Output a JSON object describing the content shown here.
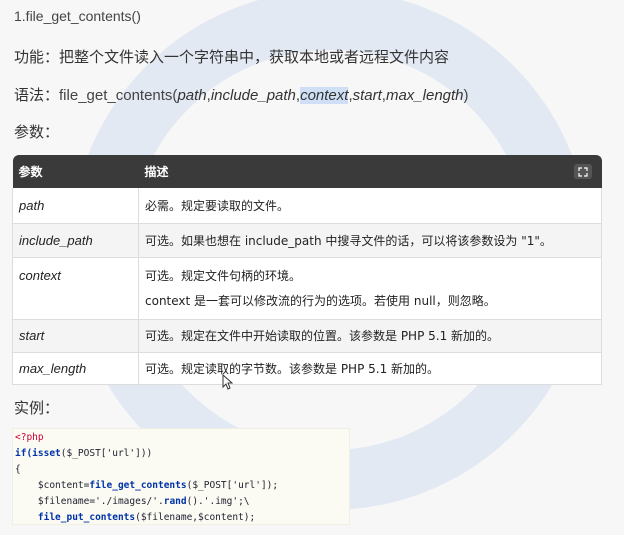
{
  "title": "1.file_get_contents()",
  "func_line": "功能：把整个文件读入一个字符串中，获取本地或者远程文件内容",
  "syntax": {
    "label": "语法：",
    "fn_name": "file_get_contents(",
    "p1": "path",
    "p2": "include_path",
    "p3": "context",
    "p4": "start",
    "p5": "max_length",
    "close": ")"
  },
  "params_label": "参数：",
  "table": {
    "col_param": "参数",
    "col_desc": "描述",
    "rows": [
      {
        "param": "path",
        "desc": "必需。规定要读取的文件。"
      },
      {
        "param": "include_path",
        "desc": "可选。如果也想在 include_path 中搜寻文件的话，可以将该参数设为 \"1\"。"
      },
      {
        "param": "context",
        "desc": "可选。规定文件句柄的环境。",
        "desc2": "context 是一套可以修改流的行为的选项。若使用 null，则忽略。"
      },
      {
        "param": "start",
        "desc": "可选。规定在文件中开始读取的位置。该参数是 PHP 5.1 新加的。"
      },
      {
        "param": "max_length",
        "desc": "可选。规定读取的字节数。该参数是 PHP 5.1 新加的。"
      }
    ]
  },
  "example_label": "实例：",
  "code": {
    "l1": "<?php",
    "l2_kw": "if(isset",
    "l2_rest": "($_POST['url']))",
    "l3": "{",
    "l4_a": "    $content=",
    "l4_fn": "file_get_contents",
    "l4_b": "($_POST['url']);",
    "l5_a": "    $filename='./images/'.",
    "l5_fn": "rand",
    "l5_b": "().'.img';\\",
    "l6_fn": "    file_put_contents",
    "l6_b": "($filename,$content);"
  },
  "icons": {
    "expand": "expand-icon",
    "cursor": "mouse-cursor-icon"
  }
}
